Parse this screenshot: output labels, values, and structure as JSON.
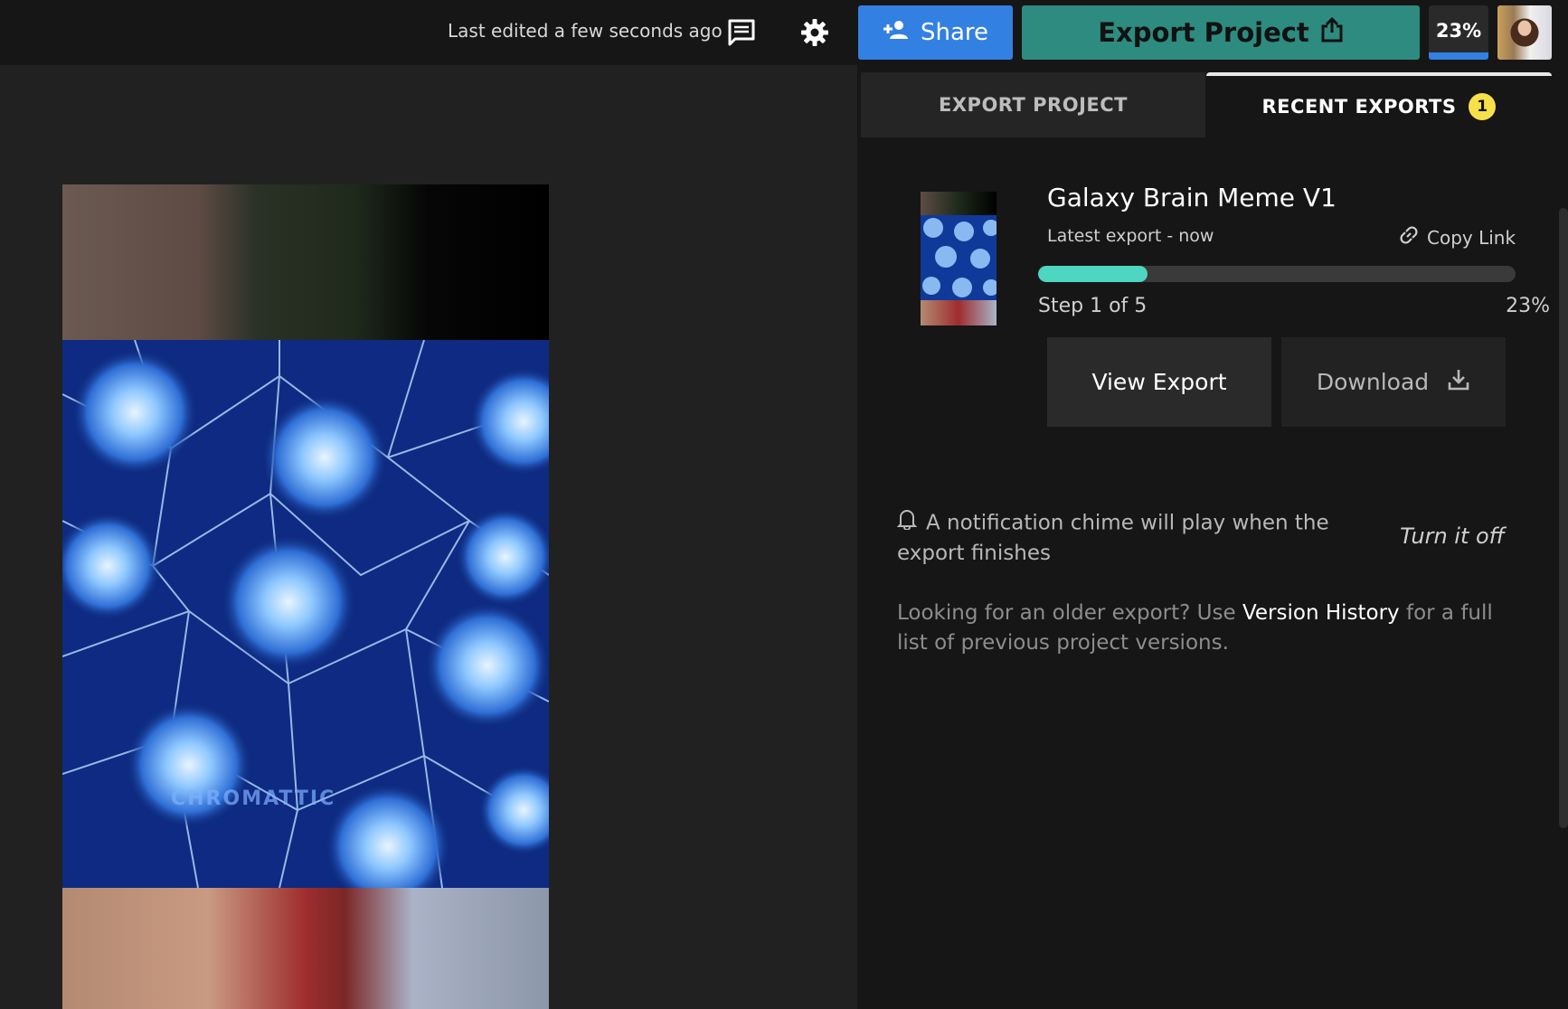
{
  "header": {
    "last_edited": "Last edited a few seconds ago",
    "share_label": "Share",
    "export_label": "Export Project",
    "progress_badge": "23%",
    "progress_fraction": 0.23
  },
  "canvas": {
    "watermark": "CHROMATTIC"
  },
  "panel": {
    "tabs": [
      {
        "label": "EXPORT PROJECT"
      },
      {
        "label": "RECENT EXPORTS",
        "badge": "1"
      }
    ],
    "export": {
      "title": "Galaxy Brain Meme V1",
      "subtitle": "Latest export - now",
      "copy_link": "Copy Link",
      "progress_fraction": 0.23,
      "step": "Step 1 of 5",
      "percent": "23%",
      "view_label": "View Export",
      "download_label": "Download"
    },
    "notification": {
      "text": "A notification chime will play when the export finishes",
      "action": "Turn it off"
    },
    "older": {
      "prefix": "Looking for an older export? Use ",
      "link": "Version History",
      "suffix": " for a full list of previous project versions."
    }
  },
  "colors": {
    "share": "#3380e3",
    "export": "#2d8b7f",
    "progress": "#4dd6c1",
    "badge": "#f7e04a"
  }
}
